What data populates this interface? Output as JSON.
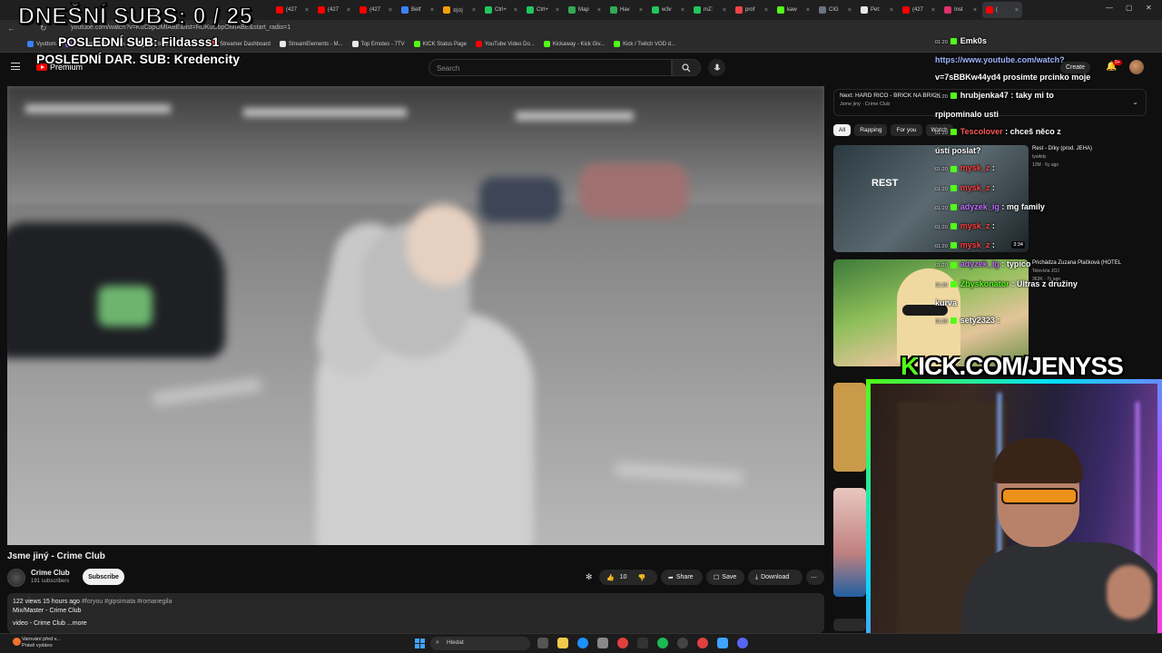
{
  "browser": {
    "tabs": [
      {
        "label": "(427",
        "color": "#ff0000"
      },
      {
        "label": "(427",
        "color": "#ff0000"
      },
      {
        "label": "(427",
        "color": "#ff0000"
      },
      {
        "label": "Betf",
        "color": "#3b82f6"
      },
      {
        "label": "와이",
        "color": "#f59e0b"
      },
      {
        "label": "Ctrl+",
        "color": "#22c55e"
      },
      {
        "label": "Ctrl+",
        "color": "#22c55e"
      },
      {
        "label": "Map",
        "color": "#34a853"
      },
      {
        "label": "Hav",
        "color": "#34a853"
      },
      {
        "label": "w3v",
        "color": "#22c55e"
      },
      {
        "label": "mZ:",
        "color": "#22c55e"
      },
      {
        "label": "prof",
        "color": "#ef4444"
      },
      {
        "label": "kaw",
        "color": "#53fc18"
      },
      {
        "label": "CIG",
        "color": "#6b7280"
      },
      {
        "label": "Pet:",
        "color": "#e5e7eb"
      },
      {
        "label": "(427",
        "color": "#ff0000"
      },
      {
        "label": "Inst",
        "color": "#e1306c"
      },
      {
        "label": "(",
        "color": "#ff0000"
      }
    ],
    "url": "youtube.com/watch?v=KuCbpOMIABE&list=RDKuCbpOMIABE&start_radio=1",
    "bookmarks": [
      {
        "label": "Vyuttom",
        "color": "#3b82f6"
      },
      {
        "label": "File Converter - Free...",
        "color": "#8b5cf6"
      },
      {
        "label": "The best ChatBot an...",
        "color": "#e5e7eb"
      },
      {
        "label": "Streamer Dashboard",
        "color": "#ef4444"
      },
      {
        "label": "StreamElements - M...",
        "color": "#e5e7eb"
      },
      {
        "label": "Top Emotes - 7TV",
        "color": "#e5e7eb"
      },
      {
        "label": "KICK Status Page",
        "color": "#53fc18"
      },
      {
        "label": "YouTube Video Do...",
        "color": "#ff0000"
      },
      {
        "label": "Kickaway - Kick Giv...",
        "color": "#53fc18"
      },
      {
        "label": "Kick / Twitch VOD d...",
        "color": "#53fc18"
      }
    ]
  },
  "overlay": {
    "subs_goal": "DNEŠNÍ SUBS: 0 / 25",
    "last_sub": "POSLEDNÍ SUB: Fildasss1",
    "last_dar": "POSLEDNÍ DAR. SUB: Kredencity",
    "kick_prefix": "K",
    "kick_rest": "ICK.COM/JENYSS"
  },
  "youtube": {
    "premium": "Premium",
    "search_placeholder": "Search",
    "create": "Create",
    "notif_count": "9+",
    "video": {
      "title": "Jsme jiný - Crime Club",
      "channel": "Crime Club",
      "subscribers": "191 subscribers",
      "subscribe": "Subscribe",
      "likes": "10",
      "share": "Share",
      "save": "Save",
      "download": "Download",
      "views_line": "122 views  15 hours ago",
      "tags": "#foryou #gipsimata #romanegila",
      "desc_line2": "Mix/Master - Crime Club",
      "desc_line3": "video - Crime Club",
      "more": "...more"
    },
    "next": {
      "title": "Next: HARD RICO - BRICK NA BRICK",
      "sub": "Jsme jiný · Crime Club"
    },
    "chips": [
      "All",
      "Rapping",
      "For you",
      "Watch"
    ],
    "recommendations": [
      {
        "title": "Rest - Díky (prod. JEHA)",
        "channel": "tyaikdy",
        "meta": "12M · 6y ago",
        "duration": "3:34",
        "thumb_text": "REST"
      },
      {
        "title": "Prichádza Zuzana Plačková (HOTEL",
        "channel": "Televízia JOJ",
        "meta": "363K · 7y ago",
        "duration": "",
        "thumb_text": ""
      }
    ]
  },
  "chat": [
    {
      "time": "01:20",
      "user": "Emk0s",
      "msg": "",
      "type": "user"
    },
    {
      "time": "",
      "user": "",
      "msg": "https://www.youtube.com/watch?",
      "type": "link"
    },
    {
      "time": "",
      "user": "",
      "msg": "v=7sBBKw44yd4 prosimte prcinko moje",
      "type": "cont"
    },
    {
      "time": "01:20",
      "user": "hrubjenka47",
      "msg": ": taky mi to",
      "type": "user"
    },
    {
      "time": "",
      "user": "",
      "msg": "rpipominalo usti",
      "type": "cont"
    },
    {
      "time": "01:20",
      "user": "Tescolover",
      "msg": ": chceš něco z",
      "type": "user"
    },
    {
      "time": "",
      "user": "",
      "msg": "ústí poslat?",
      "type": "cont"
    },
    {
      "time": "01:20",
      "user": "mysk_z",
      "msg": ":",
      "type": "user"
    },
    {
      "time": "01:20",
      "user": "mysk_z",
      "msg": ":",
      "type": "user"
    },
    {
      "time": "01:20",
      "user": "adyzek_ig",
      "msg": ": mg family",
      "type": "user"
    },
    {
      "time": "01:20",
      "user": "mysk_z",
      "msg": ":",
      "type": "user"
    },
    {
      "time": "01:20",
      "user": "mysk_z",
      "msg": ":",
      "type": "user"
    },
    {
      "time": "01:20",
      "user": "adyzek_ig",
      "msg": ": typico",
      "type": "user"
    },
    {
      "time": "01:20",
      "user": "Zbyskonator",
      "msg": ": Ultras z družiny",
      "type": "user"
    },
    {
      "time": "",
      "user": "",
      "msg": "kurva",
      "type": "cont"
    },
    {
      "time": "01:20",
      "user": "sety2323",
      "msg": ":",
      "type": "user"
    }
  ],
  "taskbar": {
    "weather_line1": "Varování před v...",
    "weather_line2": "Právě vydáno",
    "search": "Hledat"
  },
  "colors": {
    "kick_green": "#53fc18",
    "yt_red": "#ff0000",
    "bg": "#0f0f0f"
  }
}
